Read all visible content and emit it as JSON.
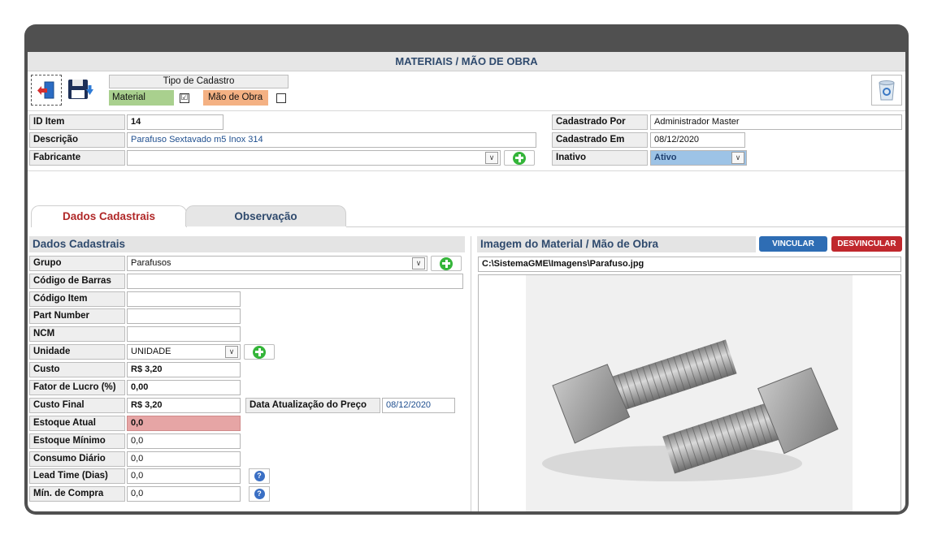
{
  "window": {
    "title": "MATERIAIS / MÃO DE OBRA"
  },
  "toolbar": {
    "exit_icon": "exit-door-icon",
    "save_icon": "save-disk-icon",
    "trash_icon": "recycle-bin-icon"
  },
  "tipo_cadastro": {
    "title": "Tipo de Cadastro",
    "material_label": "Material",
    "material_checked": true,
    "mao_de_obra_label": "Mão de Obra",
    "mao_de_obra_checked": false,
    "check_mark": "☑"
  },
  "header_fields": {
    "id_item_label": "ID Item",
    "id_item_value": "14",
    "descricao_label": "Descrição",
    "descricao_value": "Parafuso Sextavado m5 Inox 314",
    "fabricante_label": "Fabricante",
    "fabricante_value": "",
    "cadastrado_por_label": "Cadastrado Por",
    "cadastrado_por_value": "Administrador Master",
    "cadastrado_em_label": "Cadastrado Em",
    "cadastrado_em_value": "08/12/2020",
    "inativo_label": "Inativo",
    "inativo_value": "Ativo"
  },
  "tabs": {
    "dados_cadastrais": "Dados Cadastrais",
    "observacao": "Observação"
  },
  "dados": {
    "section_title": "Dados Cadastrais",
    "grupo_label": "Grupo",
    "grupo_value": "Parafusos",
    "codigo_barras_label": "Código de Barras",
    "codigo_barras_value": "",
    "codigo_item_label": "Código Item",
    "codigo_item_value": "",
    "part_number_label": "Part Number",
    "part_number_value": "",
    "ncm_label": "NCM",
    "ncm_value": "",
    "unidade_label": "Unidade",
    "unidade_value": "UNIDADE",
    "custo_label": "Custo",
    "custo_value": "R$ 3,20",
    "fator_lucro_label": "Fator de Lucro (%)",
    "fator_lucro_value": "0,00",
    "custo_final_label": "Custo Final",
    "custo_final_value": "R$ 3,20",
    "data_atualizacao_label": "Data Atualização do Preço",
    "data_atualizacao_value": "08/12/2020",
    "estoque_atual_label": "Estoque Atual",
    "estoque_atual_value": "0,0",
    "estoque_minimo_label": "Estoque Mínimo",
    "estoque_minimo_value": "0,0",
    "consumo_diario_label": "Consumo Diário",
    "consumo_diario_value": "0,0",
    "lead_time_label": "Lead Time (Dias)",
    "lead_time_value": "0,0",
    "min_compra_label": "Mín. de Compra",
    "min_compra_value": "0,0"
  },
  "imagem": {
    "section_title": "Imagem do Material / Mão de Obra",
    "vincular_label": "VINCULAR",
    "desvincular_label": "DESVINCULAR",
    "path": "C:\\SistemaGME\\Imagens\\Parafuso.jpg"
  },
  "colors": {
    "material_bg": "#a9d08e",
    "mao_de_obra_bg": "#f4b183",
    "estoque_alert_bg": "#e6a5a5",
    "inativo_bg": "#9dc3e6",
    "vincular_bg": "#2e6db4",
    "desvincular_bg": "#c0282d",
    "section_title_color": "#2f4a6d"
  }
}
